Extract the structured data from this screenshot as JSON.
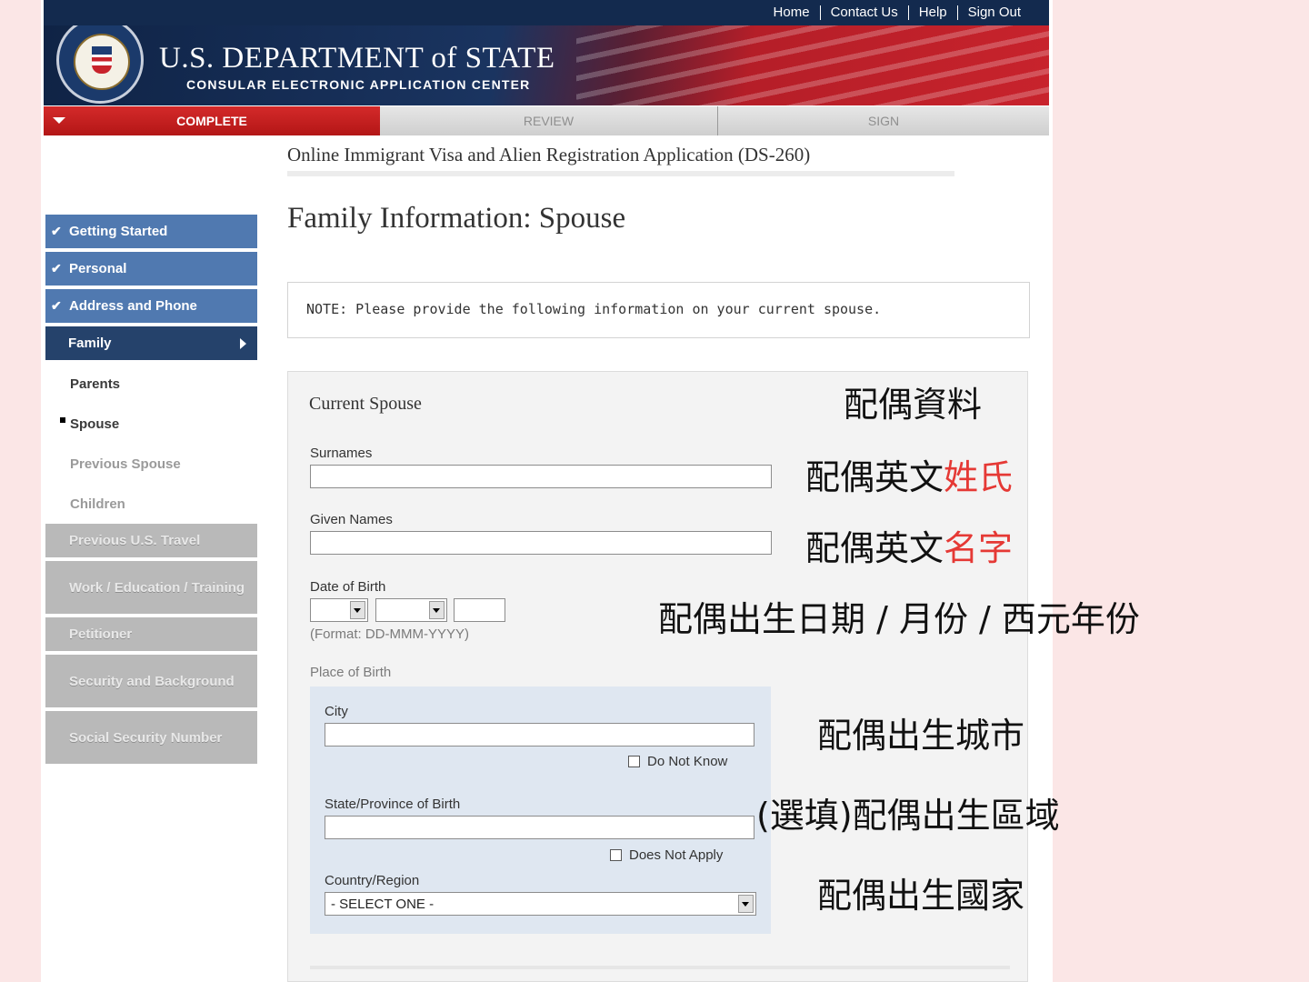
{
  "topnav": {
    "home": "Home",
    "contact": "Contact Us",
    "help": "Help",
    "signout": "Sign Out"
  },
  "header": {
    "department": "U.S. DEPARTMENT of STATE",
    "subtitle": "CONSULAR ELECTRONIC APPLICATION CENTER"
  },
  "progress": {
    "complete": "COMPLETE",
    "review": "REVIEW",
    "sign": "SIGN"
  },
  "sidebar": {
    "done": [
      "Getting Started",
      "Personal",
      "Address and Phone"
    ],
    "active": "Family",
    "sub": [
      "Parents",
      "Spouse",
      "Previous Spouse",
      "Children"
    ],
    "disabled": [
      "Previous U.S. Travel",
      "Work / Education / Training",
      "Petitioner",
      "Security and Background",
      "Social Security Number"
    ]
  },
  "main": {
    "app_title": "Online Immigrant Visa and Alien Registration Application (DS-260)",
    "heading": "Family Information: Spouse",
    "note": "NOTE: Please provide the following information on your current spouse."
  },
  "form": {
    "section": "Current Spouse",
    "surnames_label": "Surnames",
    "given_label": "Given Names",
    "dob_label": "Date of Birth",
    "dob_format": "(Format: DD-MMM-YYYY)",
    "pob_label": "Place of Birth",
    "city_label": "City",
    "city_dnk": "Do Not Know",
    "state_label": "State/Province of Birth",
    "state_dna": "Does Not Apply",
    "country_label": "Country/Region",
    "country_value": "- SELECT ONE -"
  },
  "annotations": {
    "spouse_info": "配偶資料",
    "surname_prefix": "配偶英文",
    "surname_hl": "姓氏",
    "given_prefix": "配偶英文",
    "given_hl": "名字",
    "dob": "配偶出生日期 / 月份 / 西元年份",
    "city": "配偶出生城市",
    "region": "(選填)配偶出生區域",
    "country": "配偶出生國家"
  },
  "colors": {
    "accent_red": "#e53935",
    "nav_blue": "#5079b0",
    "nav_active": "#25426b"
  }
}
